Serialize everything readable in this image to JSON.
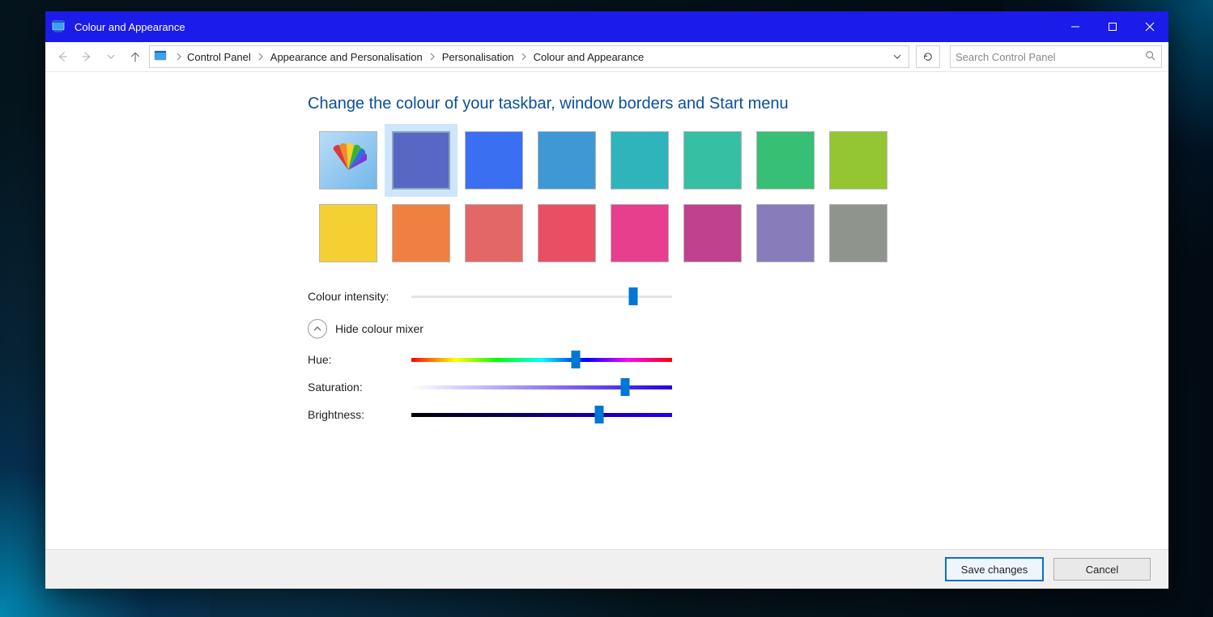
{
  "window": {
    "title": "Colour and Appearance"
  },
  "breadcrumbs": [
    "Control Panel",
    "Appearance and Personalisation",
    "Personalisation",
    "Colour and Appearance"
  ],
  "search": {
    "placeholder": "Search Control Panel"
  },
  "heading": "Change the colour of your taskbar, window borders and Start menu",
  "swatches_row1": [
    {
      "name": "custom",
      "color": "custom",
      "selected": false
    },
    {
      "name": "blue",
      "color": "#5866c4",
      "selected": true
    },
    {
      "name": "royal-blue",
      "color": "#3a6ff2",
      "selected": false
    },
    {
      "name": "sky-blue",
      "color": "#3e98d4",
      "selected": false
    },
    {
      "name": "teal",
      "color": "#2fb4bb",
      "selected": false
    },
    {
      "name": "sea-green",
      "color": "#37bfa4",
      "selected": false
    },
    {
      "name": "green",
      "color": "#38bf76",
      "selected": false
    },
    {
      "name": "lime",
      "color": "#94c533",
      "selected": false
    }
  ],
  "swatches_row2": [
    {
      "name": "yellow",
      "color": "#f4d032",
      "selected": false
    },
    {
      "name": "orange",
      "color": "#ef8042",
      "selected": false
    },
    {
      "name": "salmon",
      "color": "#e36766",
      "selected": false
    },
    {
      "name": "red",
      "color": "#ea4e65",
      "selected": false
    },
    {
      "name": "pink",
      "color": "#e83e8e",
      "selected": false
    },
    {
      "name": "magenta",
      "color": "#c0428f",
      "selected": false
    },
    {
      "name": "purple",
      "color": "#897cbb",
      "selected": false
    },
    {
      "name": "gray",
      "color": "#8f958d",
      "selected": false
    }
  ],
  "sliders": {
    "intensity": {
      "label": "Colour intensity:",
      "pct": 85
    },
    "hue": {
      "label": "Hue:",
      "pct": 63
    },
    "saturation": {
      "label": "Saturation:",
      "pct": 82
    },
    "brightness": {
      "label": "Brightness:",
      "pct": 72
    }
  },
  "mixer_toggle": "Hide colour mixer",
  "buttons": {
    "save": "Save changes",
    "cancel": "Cancel"
  }
}
